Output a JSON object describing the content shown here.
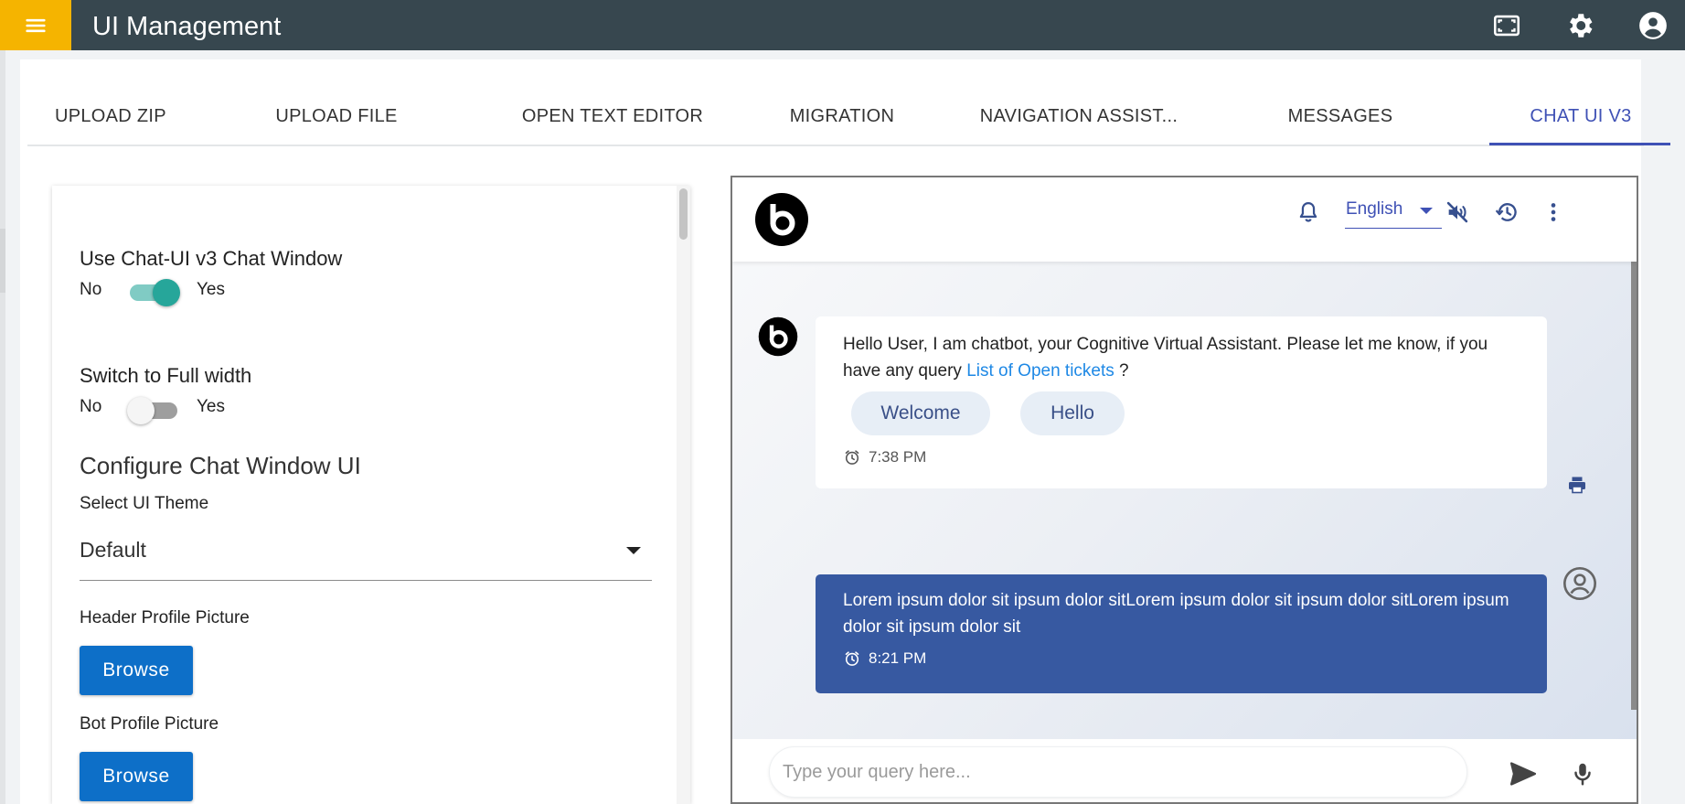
{
  "app": {
    "title": "UI Management",
    "colors": {
      "topbar": "#37474f",
      "menu_button": "#f5b400",
      "accent": "#3f51b5",
      "toggle_on": "#26a69a",
      "browse_button": "#0d6fc8",
      "user_bubble": "#3759a1"
    }
  },
  "topbar": {
    "icons": [
      "menu-icon",
      "fullscreen-icon",
      "settings-icon",
      "account-circle-icon"
    ]
  },
  "tabs": [
    {
      "label": "UPLOAD ZIP",
      "active": false
    },
    {
      "label": "UPLOAD FILE",
      "active": false
    },
    {
      "label": "OPEN TEXT EDITOR",
      "active": false
    },
    {
      "label": "MIGRATION",
      "active": false
    },
    {
      "label": "NAVIGATION ASSIST...",
      "active": false
    },
    {
      "label": "MESSAGES",
      "active": false
    },
    {
      "label": "CHAT UI V3",
      "active": true
    }
  ],
  "settings": {
    "use_chat_ui": {
      "label": "Use Chat-UI v3 Chat Window",
      "off_label": "No",
      "on_label": "Yes",
      "enabled": true
    },
    "full_width": {
      "label": "Switch to Full width",
      "off_label": "No",
      "on_label": "Yes",
      "enabled": false
    },
    "configure_title": "Configure Chat Window UI",
    "theme": {
      "label": "Select UI Theme",
      "value": "Default"
    },
    "header_picture": {
      "label": "Header Profile Picture",
      "button": "Browse"
    },
    "bot_picture": {
      "label": "Bot Profile Picture",
      "button": "Browse"
    }
  },
  "chat": {
    "header": {
      "language": "English",
      "icons": [
        "bot-logo-icon",
        "bell-icon",
        "mute-icon",
        "history-icon",
        "more-vert-icon"
      ]
    },
    "bot_message": {
      "text": "Hello User, I am chatbot, your Cognitive Virtual Assistant. Please let me know, if you have any query ",
      "link": "List of Open tickets",
      "suffix": " ?",
      "chips": [
        "Welcome",
        "Hello"
      ],
      "time": "7:38 PM"
    },
    "user_message": {
      "text": "Lorem ipsum dolor sit ipsum dolor sitLorem ipsum dolor sit ipsum dolor sitLorem ipsum dolor sit ipsum dolor sit",
      "time": "8:21 PM"
    },
    "input": {
      "placeholder": "Type your query here...",
      "value": ""
    }
  }
}
